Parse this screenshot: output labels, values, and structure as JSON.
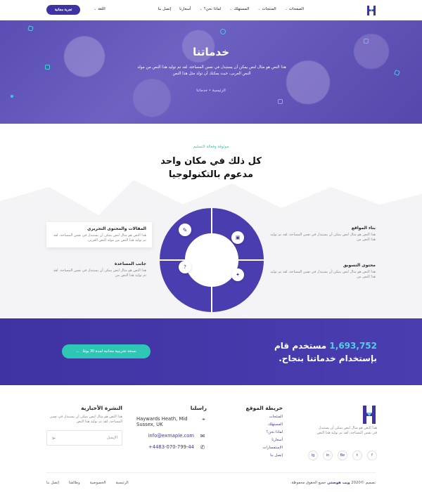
{
  "nav": {
    "menu": [
      {
        "label": "الصفحات",
        "chevron": true
      },
      {
        "label": "المنتجات",
        "chevron": true
      },
      {
        "label": "المستهلك",
        "chevron": true
      },
      {
        "label": "لماذا نحن؟",
        "chevron": true
      },
      {
        "label": "أسعارنا",
        "chevron": false
      },
      {
        "label": "إتصل بنا",
        "chevron": false
      }
    ],
    "language": "اللغة",
    "trial_button": "تجربة مجانية"
  },
  "hero": {
    "title": "خدماتنا",
    "text": "هذا النص هو مثال لنص يمكن أن يستبدل في نفس المساحة، لقد تم توليد هذا النص من مولد النص العربى، حيث يمكنك أن تولد مثل هذا النص",
    "breadcrumb_home": "الرئيسية",
    "breadcrumb_sep": "•",
    "breadcrumb_current": "خدماتنا"
  },
  "services": {
    "subtitle": "موثوقة وفعالة التسليم",
    "title_line1": "كل ذلك في مكان واحد",
    "title_line2": "مدعوم بالتكنولوجيا",
    "features": [
      {
        "title": "بناء المواقع",
        "text": "هذا النص هو مثال لنص يمكن أن يستبدل في نفس المساحة، لقد تم توليد هذا النص من"
      },
      {
        "title": "المقالات والمحتوى التحريري",
        "text": "هذا النص هو مثال لنص يمكن أن يستبدل في نفس المساحة، لقد تم توليد هذا النص من مولد النص العربى."
      },
      {
        "title": "محتوى التسويق",
        "text": "هذا النص هو مثال لنص يمكن أن يستبدل في نفس المساحة، لقد تم توليد هذا النص من"
      },
      {
        "title": "جانب المساعدة",
        "text": "هذا النص هو مثال لنص يمكن أن يستبدل في نفس المساحة، لقد تم توليد هذا النص من"
      }
    ],
    "colors": {
      "donut": "#4a3db0",
      "accent": "#2ec6b4"
    }
  },
  "cta": {
    "count": "1,693,752",
    "text_after": "مستخدم قام بإستخدام خدماتنا بنجاح.",
    "button": "نسخة تجريبية مجانية لمدة 30 يومًا",
    "button_arrow": "←"
  },
  "footer": {
    "about": "هذا النص هو مثال لنص يمكن أن يستبدل في نفس المساحة، لقد تم توليد هذا النص",
    "sitemap_title": "خريطة الموقع",
    "sitemap_links": [
      "المنتجات",
      "المستهلك",
      "لماذا نحن؟",
      "أسعارنا",
      "الإستفسارات",
      "إتصل بنا"
    ],
    "contact_title": "راسلنا",
    "address": "Haywards Heath, Mid Sussex, UK",
    "email": "info@exmaple.com",
    "phone": "+4483-070-799-44",
    "newsletter_title": "النشرة الأخبارية",
    "newsletter_text": "هذا النص هو مثال لنص يمكن أن يستبدل في نفس المساحة، لقد تم توليد هذا النص",
    "email_placeholder": "الإيميل",
    "socials": [
      "f",
      "t",
      "Be",
      "in",
      "ig"
    ],
    "copyright_prefix": "تصميم ©2020",
    "copyright_brand": "ويب هوستي",
    "copyright_suffix": "جميع الحقوق محفوظة.",
    "bottom_links": [
      "الرئيسية",
      "الخصوصية",
      "وظائفنا",
      "إتصل بنا"
    ]
  }
}
